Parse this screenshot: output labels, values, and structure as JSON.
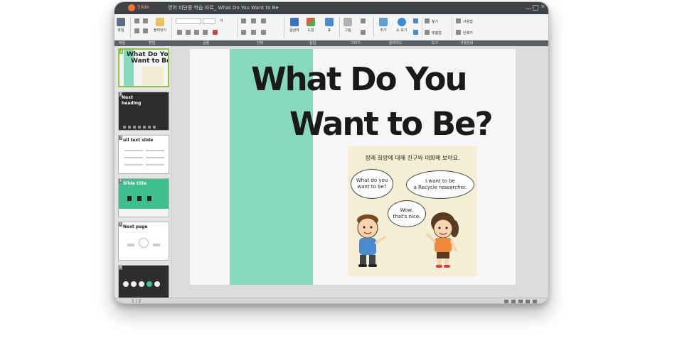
{
  "app": {
    "name": "Slide",
    "document_title": "영어 비단중 학습 자료_ What Do You Want to Be"
  },
  "ribbon": {
    "save_label": "파일",
    "paste_label": "붙여넣기",
    "text_box_label": "글상자",
    "shape_label": "도형",
    "table_label": "표",
    "picture_label": "그림",
    "add_slide_label": "추가",
    "show_label": "쇼 보기",
    "comment1_label": "찾기",
    "comment2_label": "맞춤법",
    "tool1_label": "사용법",
    "tool2_label": "단축키",
    "aa_label": "가"
  },
  "groups": [
    "파일",
    "편집",
    "글꼴",
    "단락",
    "삽입",
    "그리기",
    "슬라이드",
    "도구",
    "사용안내"
  ],
  "thumbnails": [
    {
      "num": "1",
      "line1": "What Do You",
      "line2": "Want to Be?"
    },
    {
      "num": "2",
      "line1": "Next",
      "line2": "heading"
    },
    {
      "num": "3",
      "line1": "ull text slide",
      "line2": ""
    },
    {
      "num": "4",
      "line1": "Slide title",
      "line2": ""
    },
    {
      "num": "5",
      "line1": "Next page",
      "line2": ""
    },
    {
      "num": "6",
      "line1": "",
      "line2": ""
    }
  ],
  "slide": {
    "title_line1": "What Do You",
    "title_line2": "Want to Be?",
    "caption": "장래 희망에 대해 친구와 대화해 보아요.",
    "bubble_left_1": "What do you",
    "bubble_left_2": "want to be?",
    "bubble_right_1": "I want to be",
    "bubble_right_2": "a Recycle researcher.",
    "bubble_mid_1": "Wow,",
    "bubble_mid_2": "that's nice."
  },
  "status": {
    "page_indicator": "1 / 2"
  },
  "colors": {
    "accent_band": "#86d9bf",
    "thumb_selected": "#8cc63f",
    "app_logo": "#f07830"
  }
}
